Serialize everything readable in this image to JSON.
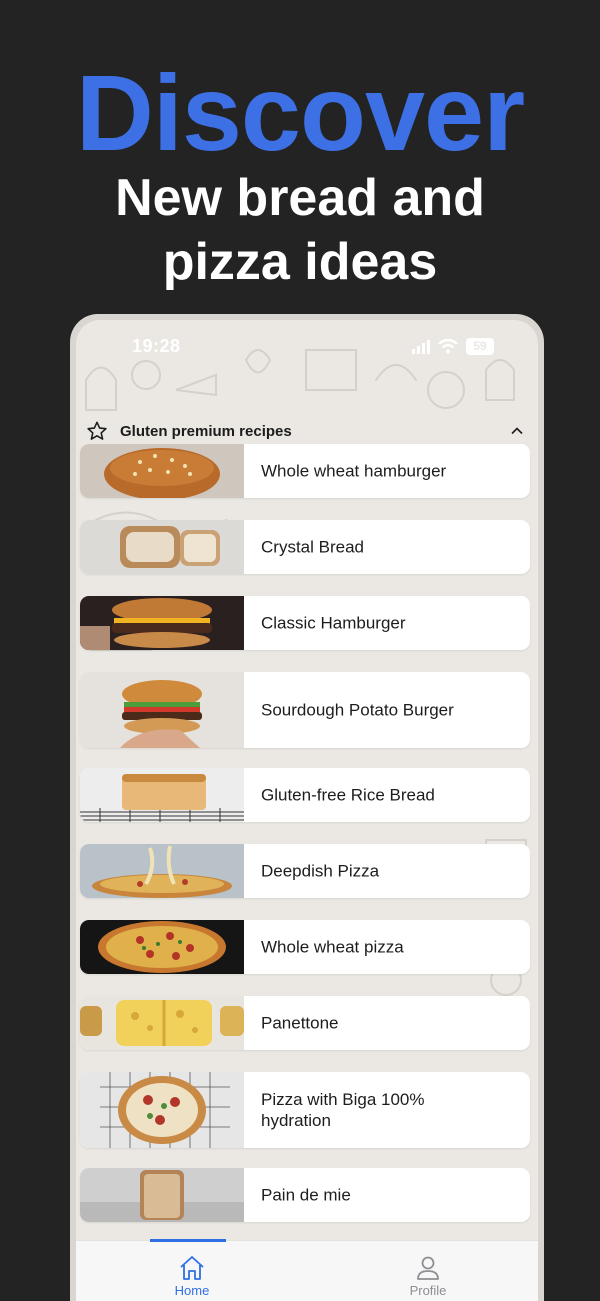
{
  "promo": {
    "title": "Discover",
    "subtitle_line1": "New bread and",
    "subtitle_line2": "pizza ideas",
    "title_color": "#3d6fe5"
  },
  "status_bar": {
    "time": "19:28",
    "battery": "59"
  },
  "section": {
    "title": "Gluten premium recipes",
    "icon": "star-outline-icon",
    "toggle_icon": "chevron-up-icon"
  },
  "recipes": [
    {
      "label": "Whole wheat hamburger",
      "thumb": "hamburger-bun-photo"
    },
    {
      "label": "Crystal Bread",
      "thumb": "crystal-bread-photo"
    },
    {
      "label": "Classic Hamburger",
      "thumb": "classic-hamburger-photo"
    },
    {
      "label": "Sourdough Potato Burger",
      "thumb": "potato-burger-photo"
    },
    {
      "label": "Gluten-free Rice Bread",
      "thumb": "rice-bread-photo"
    },
    {
      "label": "Deepdish Pizza",
      "thumb": "deepdish-pizza-photo"
    },
    {
      "label": "Whole wheat pizza",
      "thumb": "whole-wheat-pizza-photo"
    },
    {
      "label": "Panettone",
      "thumb": "panettone-photo"
    },
    {
      "label": "Pizza with Biga 100% hydration",
      "thumb": "biga-pizza-photo"
    },
    {
      "label": "Pain de mie",
      "thumb": "pain-de-mie-photo"
    }
  ],
  "tabbar": {
    "home": {
      "label": "Home",
      "icon": "home-icon",
      "active": true
    },
    "profile": {
      "label": "Profile",
      "icon": "person-icon",
      "active": false
    },
    "active_color": "#2f6fe4",
    "inactive_color": "#8e8e93"
  }
}
